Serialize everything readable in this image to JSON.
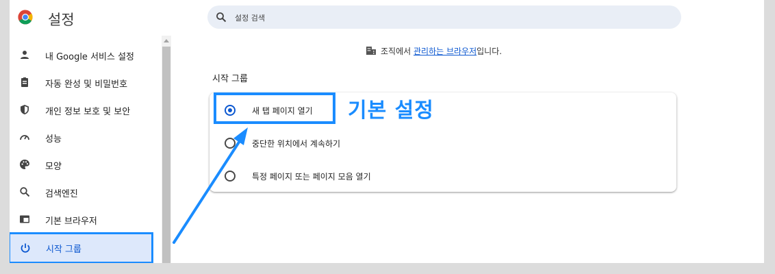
{
  "app": {
    "title": "설정"
  },
  "search": {
    "placeholder": "설정 검색"
  },
  "sidebar": {
    "items": [
      {
        "label": "내 Google 서비스 설정",
        "icon": "person-icon"
      },
      {
        "label": "자동 완성 및 비밀번호",
        "icon": "clipboard-icon"
      },
      {
        "label": "개인 정보 보호 및 보안",
        "icon": "shield-icon"
      },
      {
        "label": "성능",
        "icon": "speedometer-icon"
      },
      {
        "label": "모양",
        "icon": "palette-icon"
      },
      {
        "label": "검색엔진",
        "icon": "search-icon"
      },
      {
        "label": "기본 브라우저",
        "icon": "browser-icon"
      },
      {
        "label": "시작 그룹",
        "icon": "power-icon",
        "active": true
      }
    ]
  },
  "notice": {
    "prefix": "조직에서",
    "link": "관리하는 브라우저",
    "suffix": "입니다."
  },
  "section": {
    "title": "시작 그룹"
  },
  "startup": {
    "options": [
      {
        "label": "새 탭 페이지 열기",
        "selected": true
      },
      {
        "label": "중단한 위치에서 계속하기",
        "selected": false
      },
      {
        "label": "특정 페이지 또는 페이지 모음 열기",
        "selected": false
      }
    ]
  },
  "annotation": {
    "callout": "기본 설정",
    "color": "#1a8cff"
  },
  "colors": {
    "accent": "#0b57d0",
    "active_bg": "#dde8fb",
    "annotation": "#1a8cff"
  }
}
